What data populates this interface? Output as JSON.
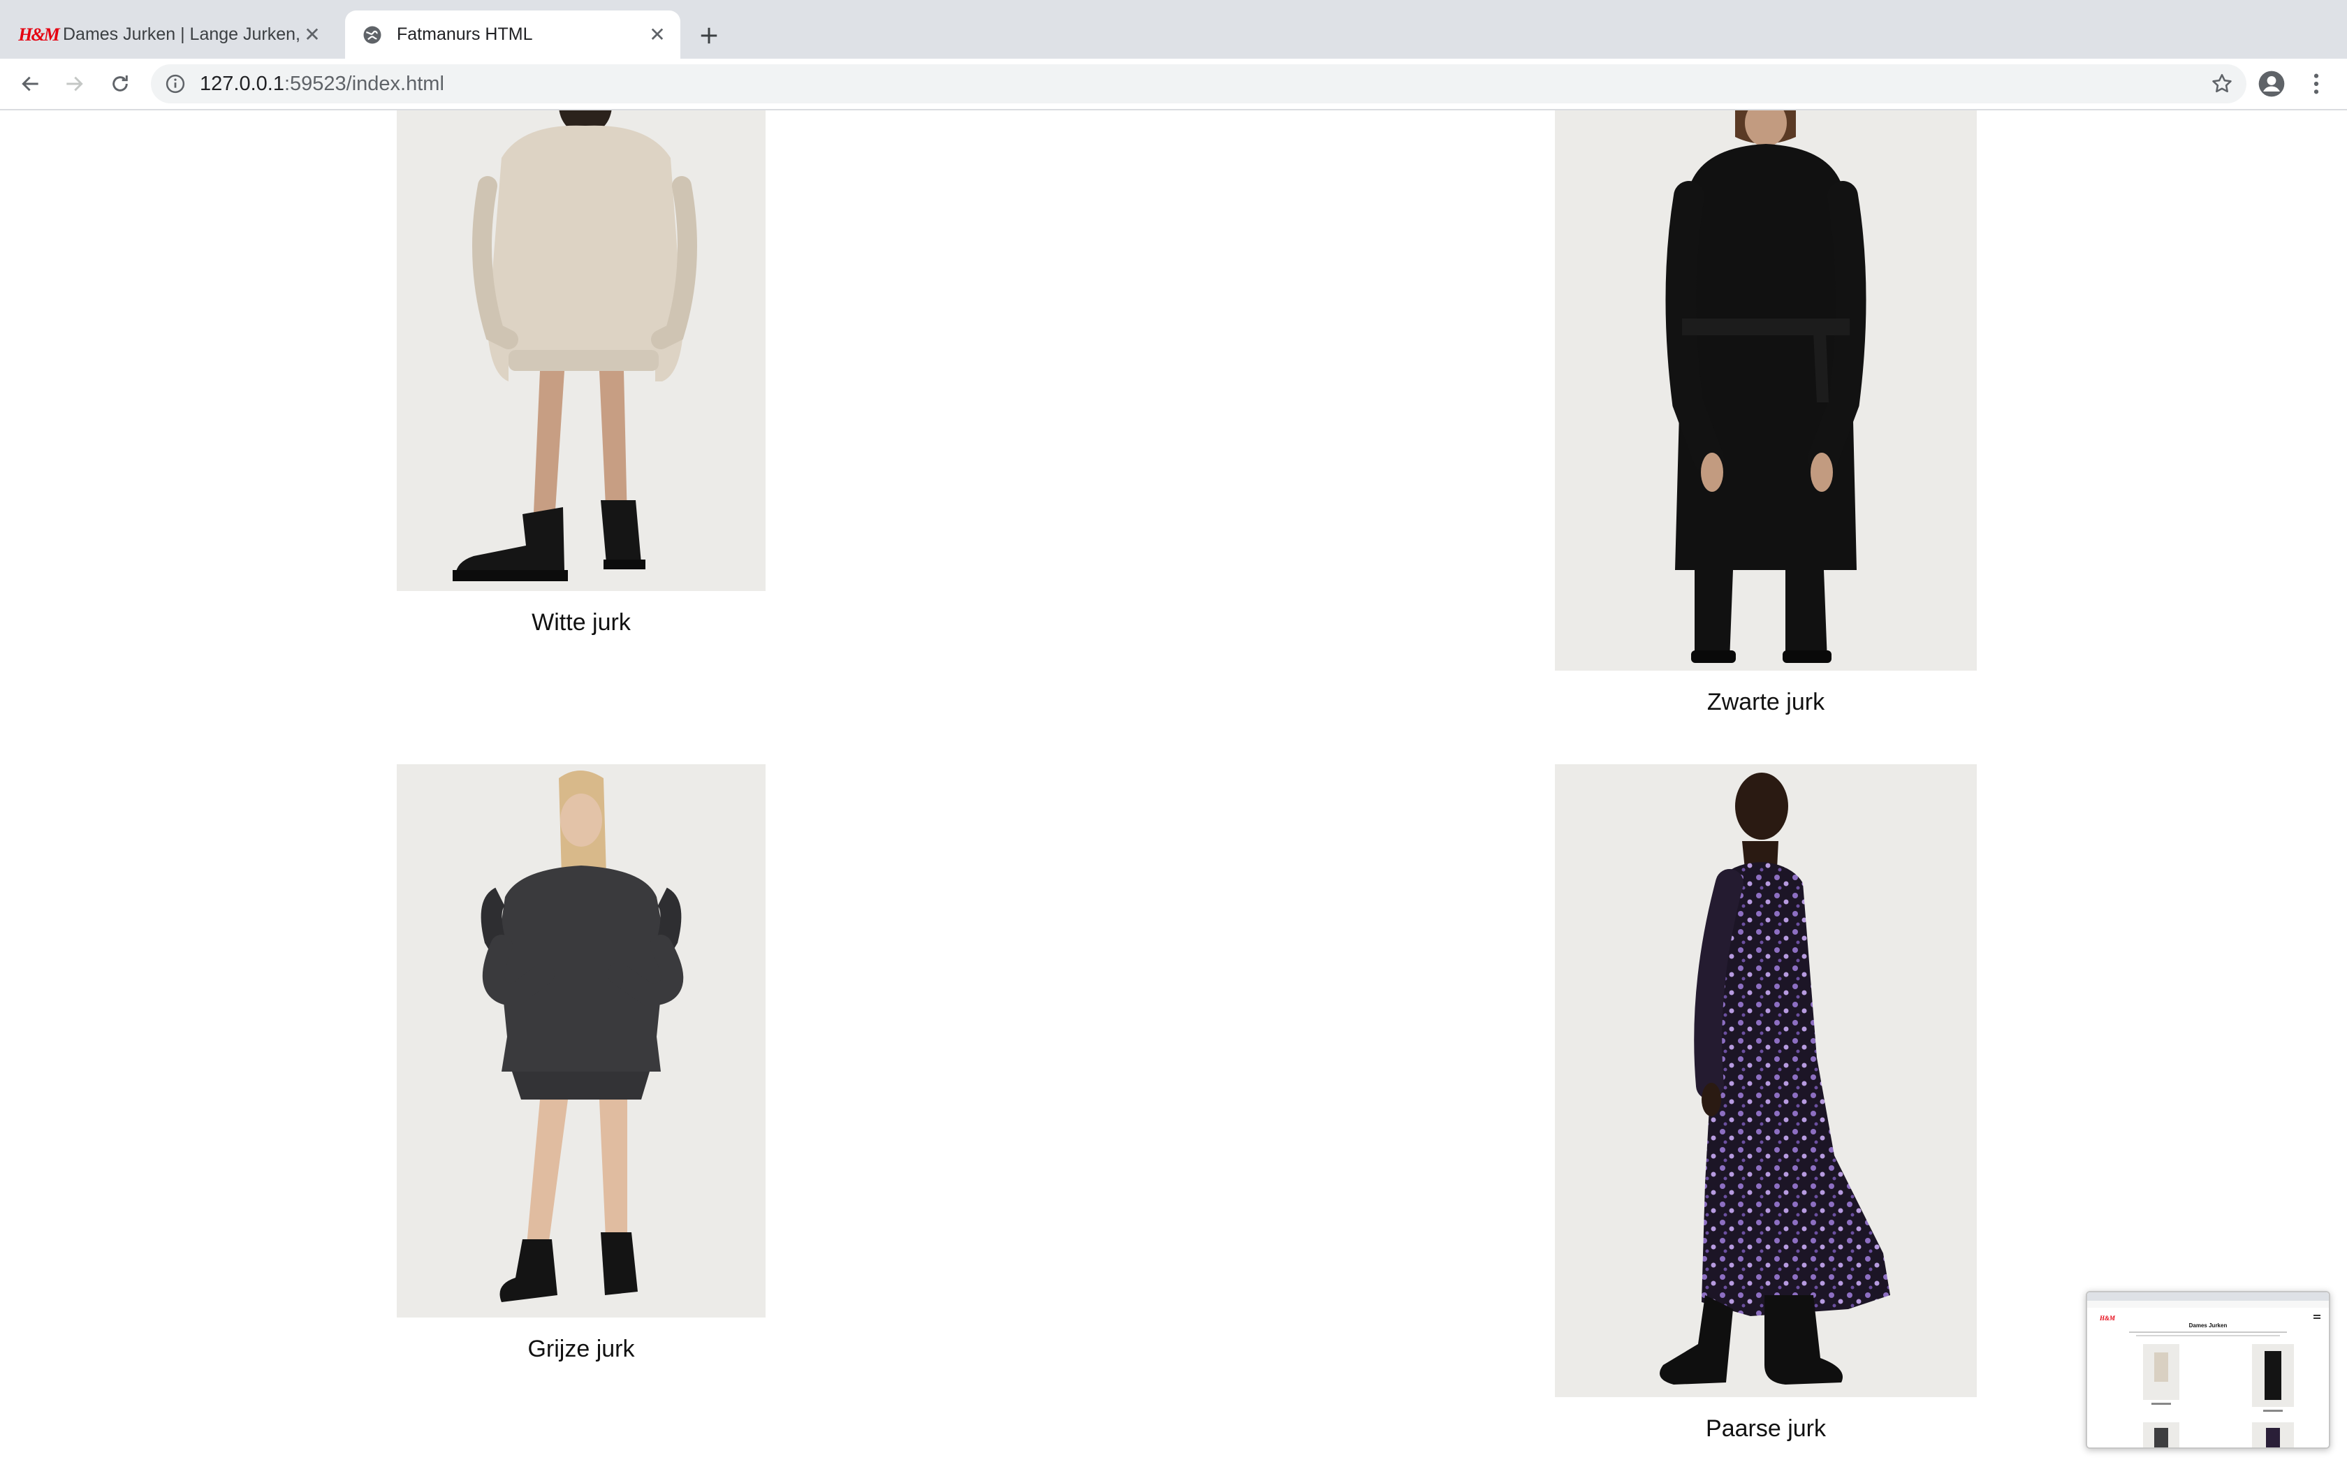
{
  "browser": {
    "tabs": [
      {
        "title": "Dames Jurken | Lange Jurken, Mini Jurken",
        "favicon": "hm-logo-icon",
        "logo_text": "H&M",
        "active": false
      },
      {
        "title": "Fatmanurs HTML",
        "favicon": "globe-icon",
        "active": true
      }
    ],
    "address": {
      "host": "127.0.0.1",
      "rest": ":59523/index.html"
    },
    "accent": "#dee1e6"
  },
  "products": [
    {
      "label": "Witte jurk",
      "color": "#d9d0c2"
    },
    {
      "label": "Zwarte jurk",
      "color": "#141414"
    },
    {
      "label": "Grijze jurk",
      "color": "#3e3e40"
    },
    {
      "label": "Paarse jurk",
      "color": "#2a1f38"
    }
  ],
  "preview": {
    "title": "Dames Jurken"
  }
}
